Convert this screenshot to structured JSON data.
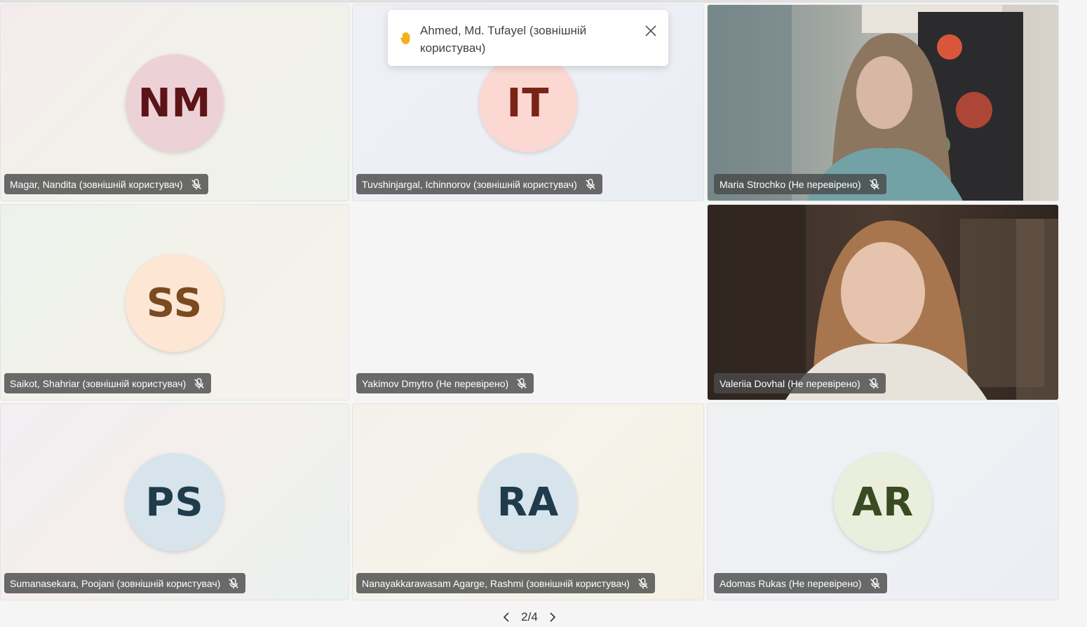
{
  "notification": {
    "text": "Ahmed, Md. Tufayel (зовнішній користувач)",
    "hand_icon": "raised-hand-icon",
    "close_icon": "close-icon"
  },
  "tiles": [
    {
      "initials": "NM",
      "name": "Magar, Nandita (зовнішній користувач)",
      "avatar_bg": "#ecd2d6",
      "avatar_fg": "#5c1418"
    },
    {
      "initials": "IT",
      "name": "Tuvshinjargal, Ichinnorov (зовнішній користувач)",
      "avatar_bg": "#fbd8d2",
      "avatar_fg": "#7a2417"
    },
    {
      "video": true,
      "name": "Maria Strochko (Не перевірено)"
    },
    {
      "initials": "SS",
      "name": "Saikot, Shahriar (зовнішній користувач)",
      "avatar_bg": "#fde6d3",
      "avatar_fg": "#7a4a20"
    },
    {
      "empty": true,
      "name": "Yakimov Dmytro (Не перевірено)"
    },
    {
      "video": true,
      "name": "Valeriia Dovhal (Не перевірено)"
    },
    {
      "initials": "PS",
      "name": "Sumanasekara, Poojani (зовнішній користувач)",
      "avatar_bg": "#d8e4ec",
      "avatar_fg": "#1e3c4c"
    },
    {
      "initials": "RA",
      "name": "Nanayakkarawasam Agarge, Rashmi (зовнішній користувач)",
      "avatar_bg": "#d8e4ec",
      "avatar_fg": "#1e3c4c"
    },
    {
      "initials": "AR",
      "name": "Adomas Rukas (Не перевірено)",
      "avatar_bg": "#e9efdc",
      "avatar_fg": "#3a4a22"
    }
  ],
  "pager": {
    "label": "2/4"
  },
  "colors": {
    "background": "#f5f5f5",
    "nametag_bg": "#4b4b4b",
    "raise_hand": "#f2b01e"
  }
}
